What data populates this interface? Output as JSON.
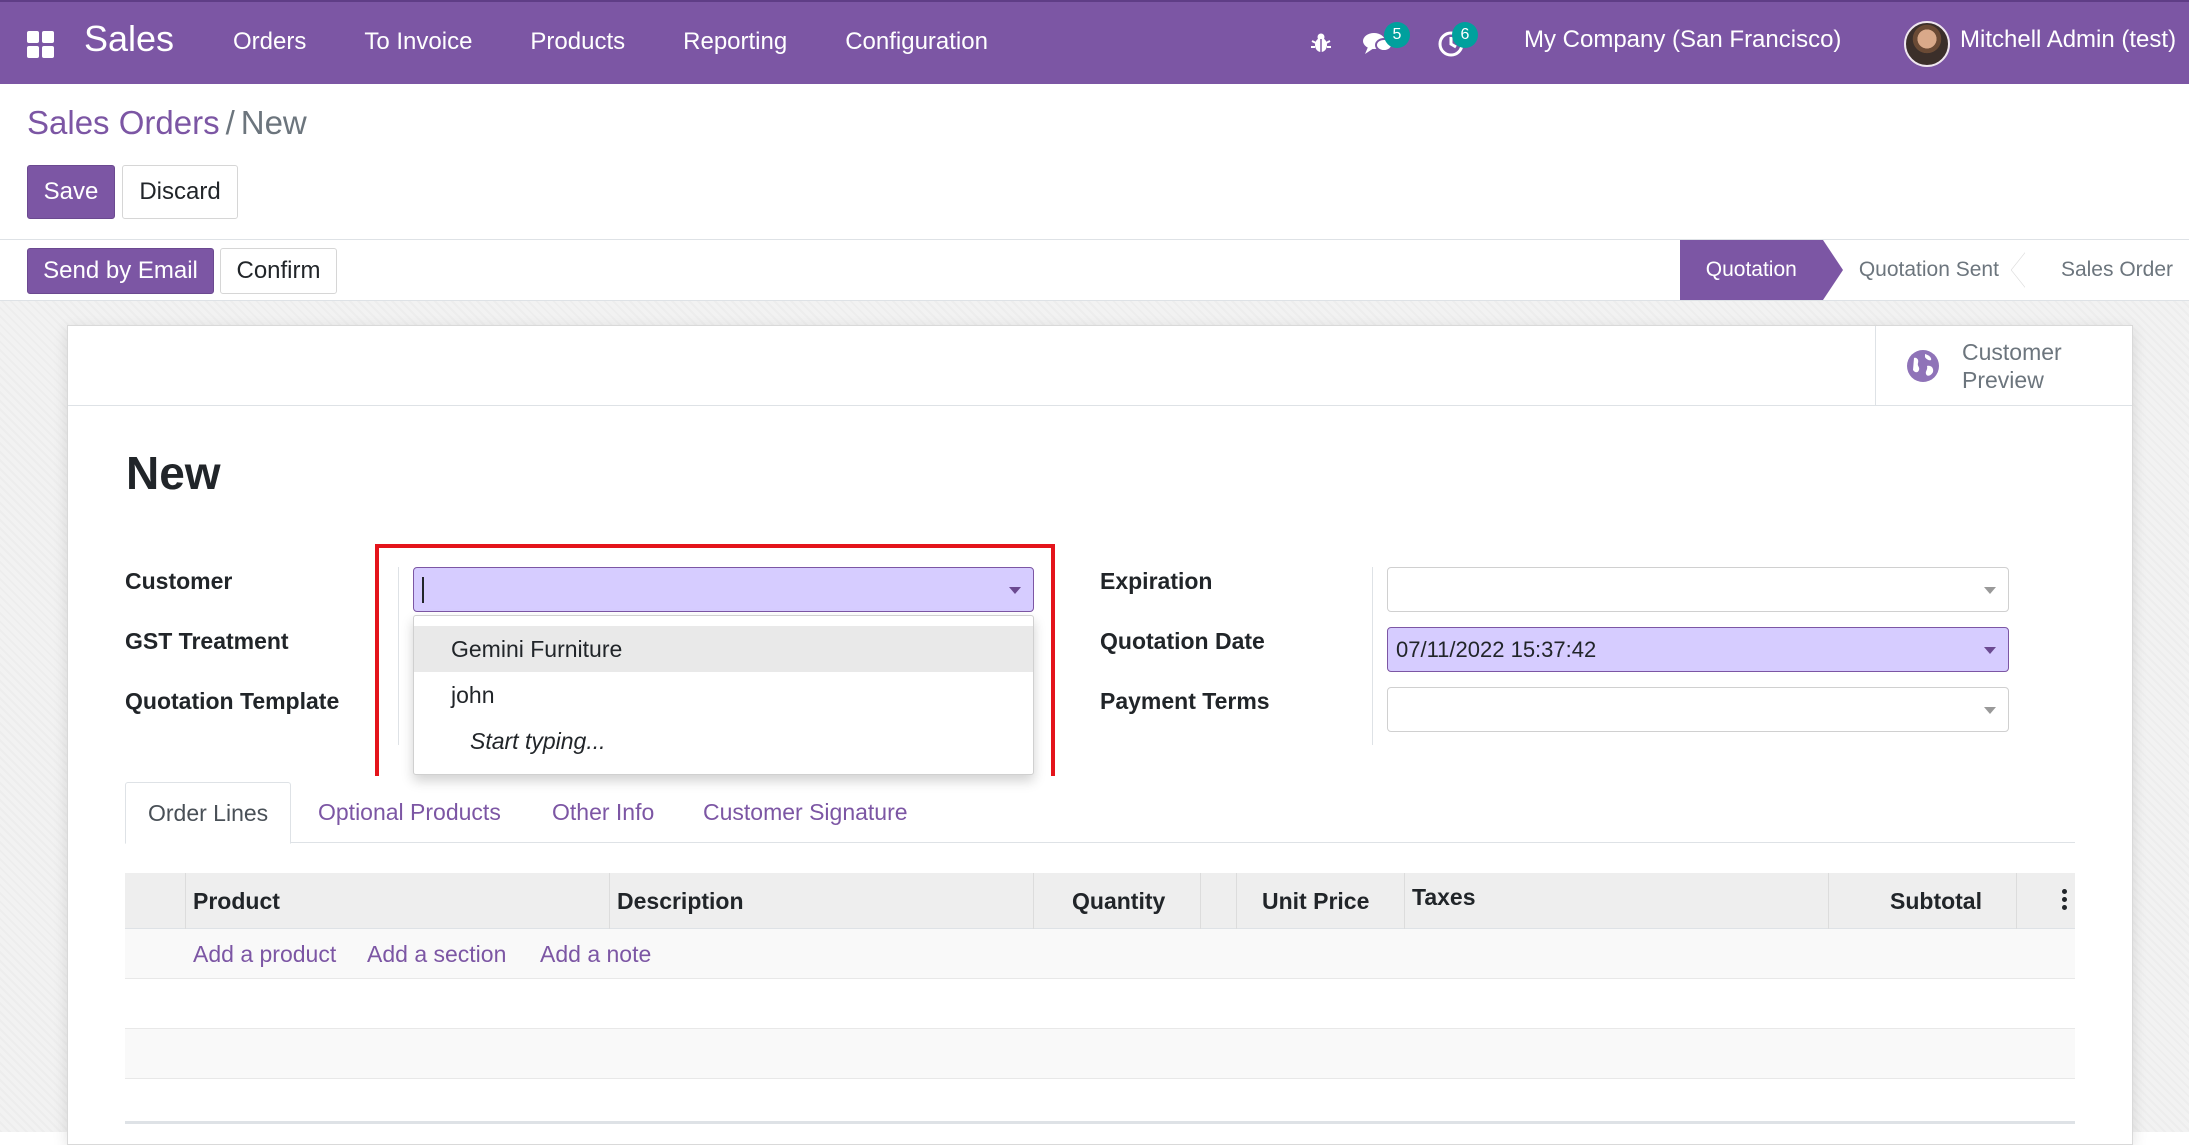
{
  "navbar": {
    "app_name": "Sales",
    "menu": [
      "Orders",
      "To Invoice",
      "Products",
      "Reporting",
      "Configuration"
    ],
    "messages_count": "5",
    "activities_count": "6",
    "company": "My Company (San Francisco)",
    "user": "Mitchell Admin (test)"
  },
  "breadcrumb": {
    "parent": "Sales Orders",
    "separator": "/",
    "current": "New"
  },
  "actions": {
    "save": "Save",
    "discard": "Discard",
    "send_by_email": "Send by Email",
    "confirm": "Confirm"
  },
  "statusbar": {
    "steps": [
      "Quotation",
      "Quotation Sent",
      "Sales Order"
    ],
    "active": "Quotation"
  },
  "sheet": {
    "customer_preview": "Customer Preview",
    "title": "New"
  },
  "form": {
    "customer_label": "Customer",
    "gst_label": "GST Treatment",
    "template_label": "Quotation Template",
    "customer_value": "",
    "expiration_label": "Expiration",
    "expiration_value": "",
    "quotation_date_label": "Quotation Date",
    "quotation_date_value": "07/11/2022 15:37:42",
    "payment_terms_label": "Payment Terms",
    "payment_terms_value": ""
  },
  "customer_dropdown": {
    "options": [
      "Gemini Furniture",
      "john"
    ],
    "hint": "Start typing..."
  },
  "tabs": [
    "Order Lines",
    "Optional Products",
    "Other Info",
    "Customer Signature"
  ],
  "table": {
    "columns": [
      "Product",
      "Description",
      "Quantity",
      "Unit Price",
      "Taxes",
      "Subtotal"
    ],
    "add_product": "Add a product",
    "add_section": "Add a section",
    "add_note": "Add a note"
  },
  "colors": {
    "brand": "#7c56a4",
    "focus_fill": "#d6ccff",
    "badge": "#00a09d",
    "annotation": "#e4141b"
  }
}
